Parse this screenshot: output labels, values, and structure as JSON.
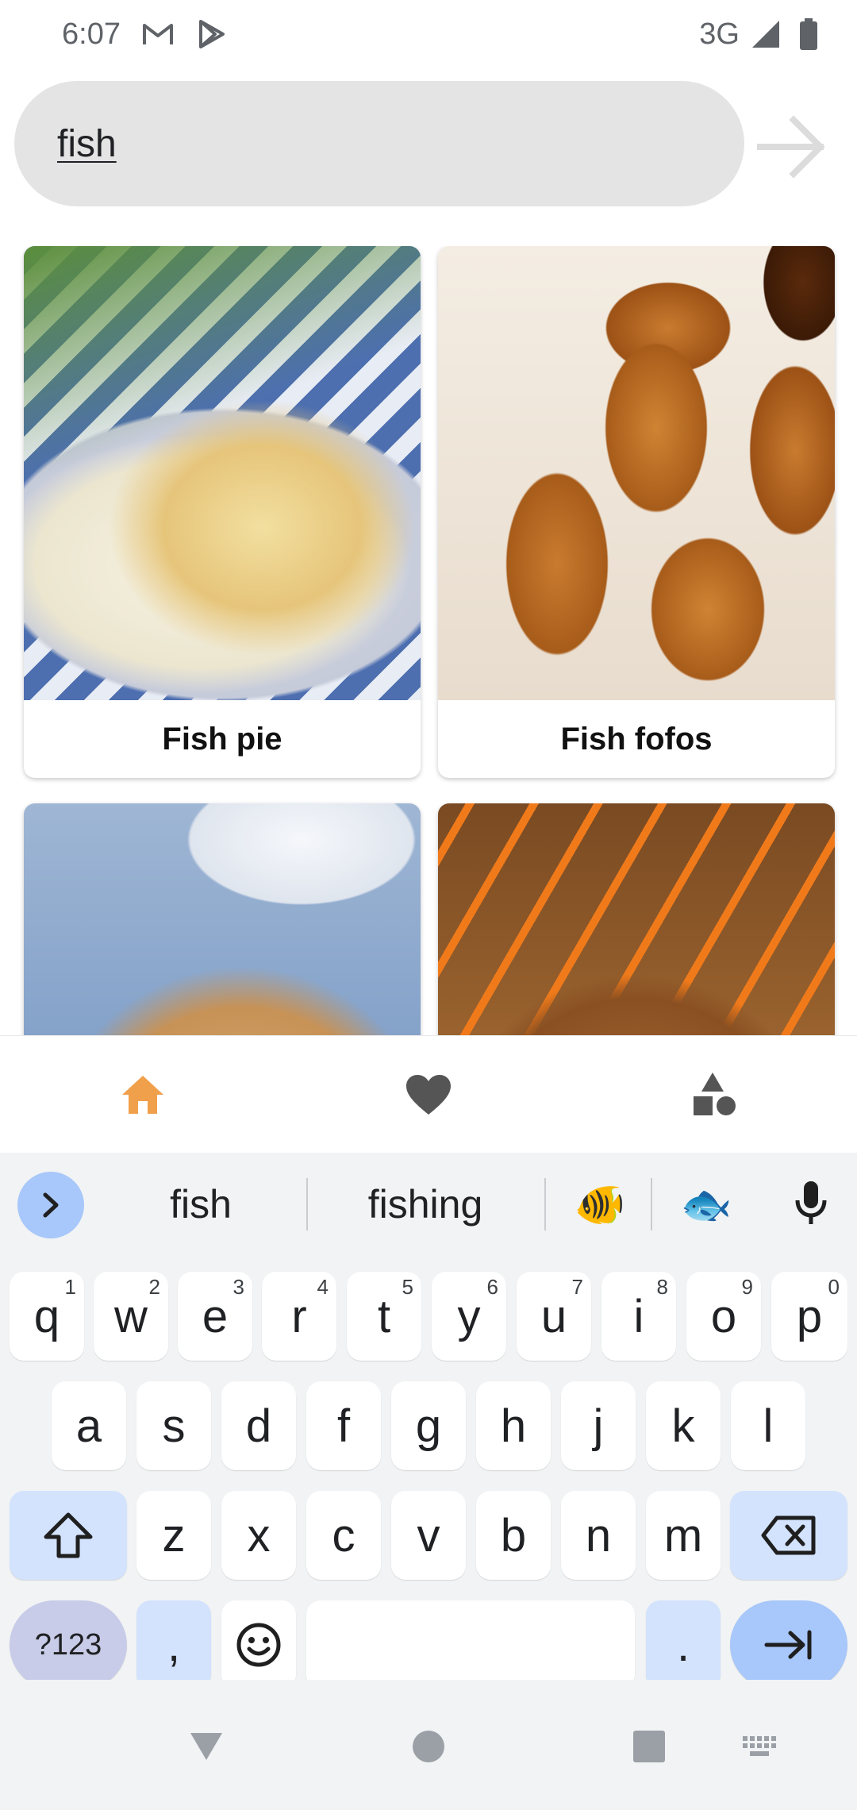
{
  "status_bar": {
    "time": "6:07",
    "left_icons": [
      "gmail-icon",
      "play-store-icon"
    ],
    "network": "3G",
    "right_icons": [
      "signal-icon",
      "battery-icon"
    ]
  },
  "search": {
    "query": "fish",
    "submit_icon": "arrow-right-icon"
  },
  "results": [
    {
      "title": "Fish pie",
      "image": "fish-pie-photo"
    },
    {
      "title": "Fish fofos",
      "image": "fish-fofos-photo"
    },
    {
      "title": "",
      "image": "fish-bake-photo"
    },
    {
      "title": "",
      "image": "fish-curry-photo"
    }
  ],
  "bottom_nav": {
    "items": [
      {
        "icon": "home-icon",
        "active": true,
        "color": "#f0a04b"
      },
      {
        "icon": "heart-icon",
        "active": false,
        "color": "#555555"
      },
      {
        "icon": "categories-icon",
        "active": false,
        "color": "#555555"
      }
    ]
  },
  "keyboard": {
    "suggestions": [
      "fish",
      "fishing"
    ],
    "emoji_suggestions": [
      "🐠",
      "🐟"
    ],
    "row1": [
      {
        "key": "q",
        "hint": "1"
      },
      {
        "key": "w",
        "hint": "2"
      },
      {
        "key": "e",
        "hint": "3"
      },
      {
        "key": "r",
        "hint": "4"
      },
      {
        "key": "t",
        "hint": "5"
      },
      {
        "key": "y",
        "hint": "6"
      },
      {
        "key": "u",
        "hint": "7"
      },
      {
        "key": "i",
        "hint": "8"
      },
      {
        "key": "o",
        "hint": "9"
      },
      {
        "key": "p",
        "hint": "0"
      }
    ],
    "row2": [
      "a",
      "s",
      "d",
      "f",
      "g",
      "h",
      "j",
      "k",
      "l"
    ],
    "row3": [
      "z",
      "x",
      "c",
      "v",
      "b",
      "n",
      "m"
    ],
    "symbols_label": "?123",
    "comma": ",",
    "period": ".",
    "accent_color": "#a8c7fa"
  }
}
